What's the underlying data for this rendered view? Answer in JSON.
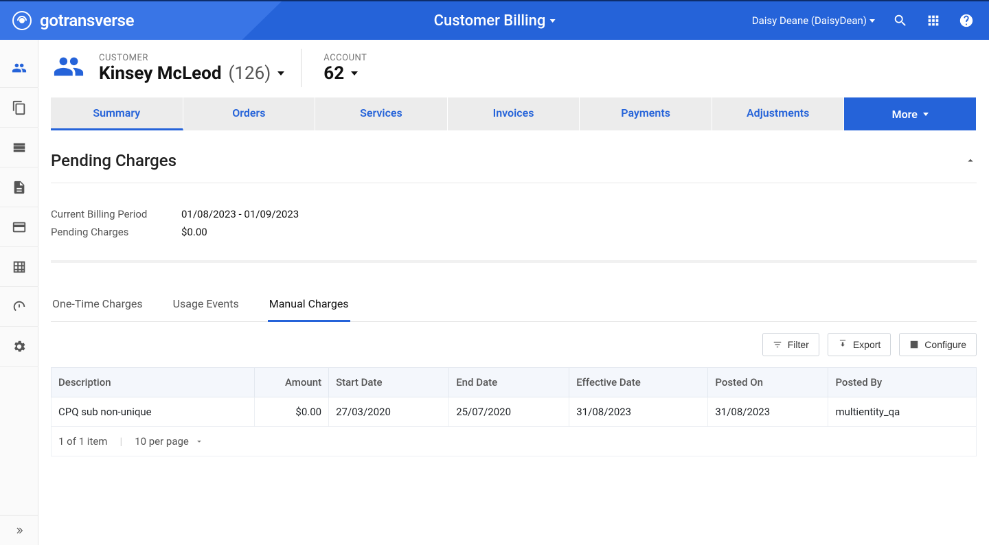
{
  "brand": {
    "name": "gotransverse"
  },
  "topbar": {
    "title": "Customer Billing",
    "user_display": "Daisy Deane (DaisyDean)"
  },
  "sidebar": {
    "icons": [
      "users",
      "copy",
      "rows",
      "document",
      "card",
      "grid",
      "dashboard",
      "settings"
    ]
  },
  "header": {
    "customer_label": "CUSTOMER",
    "customer_name": "Kinsey McLeod",
    "customer_id_display": "(126)",
    "account_label": "ACCOUNT",
    "account_number": "62"
  },
  "tabs": {
    "items": [
      "Summary",
      "Orders",
      "Services",
      "Invoices",
      "Payments",
      "Adjustments"
    ],
    "more_label": "More"
  },
  "pending": {
    "title": "Pending Charges",
    "kv": {
      "period_label": "Current Billing Period",
      "period_value": "01/08/2023 - 01/09/2023",
      "charges_label": "Pending Charges",
      "charges_value": "$0.00"
    }
  },
  "subtabs": {
    "items": [
      "One-Time Charges",
      "Usage Events",
      "Manual Charges"
    ],
    "active_index": 2
  },
  "toolbar": {
    "filter": "Filter",
    "export": "Export",
    "configure": "Configure"
  },
  "table": {
    "columns": {
      "description": "Description",
      "amount": "Amount",
      "start": "Start Date",
      "end": "End Date",
      "effective": "Effective Date",
      "posted_on": "Posted On",
      "posted_by": "Posted By"
    },
    "rows": [
      {
        "description": "CPQ sub non-unique",
        "amount": "$0.00",
        "start": "27/03/2020",
        "end": "25/07/2020",
        "effective": "31/08/2023",
        "posted_on": "31/08/2023",
        "posted_by": "multientity_qa"
      }
    ],
    "pager": {
      "summary": "1 of 1 item",
      "per_page": "10 per page"
    }
  }
}
